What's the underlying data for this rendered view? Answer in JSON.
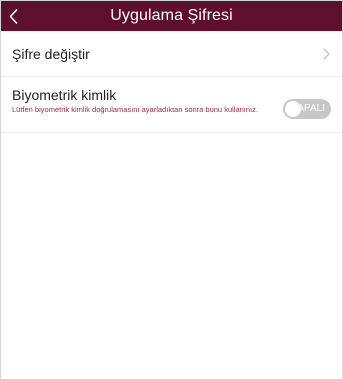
{
  "header": {
    "title": "Uygulama Şifresi",
    "back_icon": "chevron-left-icon"
  },
  "change_password": {
    "label": "Şifre değiştir",
    "chevron_icon": "chevron-right-icon"
  },
  "biometric": {
    "title": "Biyometrik kimlik",
    "description": "Lütfen biyometrik kimlik doğrulamasını ayarladıktan sonra bunu kullanınız.",
    "toggle_label": "KAPALI",
    "enabled": false
  },
  "colors": {
    "header_bg": "#5e0f2e",
    "accent_text": "#a0294e",
    "toggle_off": "#c7c7c7"
  }
}
